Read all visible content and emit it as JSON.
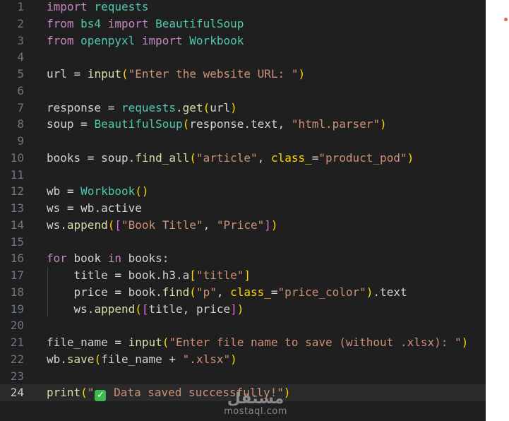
{
  "editor": {
    "active_line": 24,
    "lines": [
      {
        "n": "1",
        "tokens": [
          {
            "t": "import",
            "c": "tk-kw"
          },
          {
            "t": " requests",
            "c": "tk-mod"
          }
        ]
      },
      {
        "n": "2",
        "tokens": [
          {
            "t": "from",
            "c": "tk-kw"
          },
          {
            "t": " bs4 ",
            "c": "tk-mod"
          },
          {
            "t": "import",
            "c": "tk-kw"
          },
          {
            "t": " BeautifulSoup",
            "c": "tk-mod"
          }
        ]
      },
      {
        "n": "3",
        "tokens": [
          {
            "t": "from",
            "c": "tk-kw"
          },
          {
            "t": " openpyxl ",
            "c": "tk-mod"
          },
          {
            "t": "import",
            "c": "tk-kw"
          },
          {
            "t": " Workbook",
            "c": "tk-mod"
          }
        ]
      },
      {
        "n": "4",
        "tokens": []
      },
      {
        "n": "5",
        "tokens": [
          {
            "t": "url",
            "c": "tk-plain"
          },
          {
            "t": " = ",
            "c": "tk-plain"
          },
          {
            "t": "input",
            "c": "tk-fn"
          },
          {
            "t": "(",
            "c": "tk-br1"
          },
          {
            "t": "\"Enter the website URL: \"",
            "c": "tk-str"
          },
          {
            "t": ")",
            "c": "tk-br1"
          }
        ]
      },
      {
        "n": "6",
        "tokens": []
      },
      {
        "n": "7",
        "tokens": [
          {
            "t": "response",
            "c": "tk-plain"
          },
          {
            "t": " = ",
            "c": "tk-plain"
          },
          {
            "t": "requests",
            "c": "tk-mod"
          },
          {
            "t": ".",
            "c": "tk-plain"
          },
          {
            "t": "get",
            "c": "tk-fn"
          },
          {
            "t": "(",
            "c": "tk-br1"
          },
          {
            "t": "url",
            "c": "tk-plain"
          },
          {
            "t": ")",
            "c": "tk-br1"
          }
        ]
      },
      {
        "n": "8",
        "tokens": [
          {
            "t": "soup",
            "c": "tk-plain"
          },
          {
            "t": " = ",
            "c": "tk-plain"
          },
          {
            "t": "BeautifulSoup",
            "c": "tk-mod"
          },
          {
            "t": "(",
            "c": "tk-br1"
          },
          {
            "t": "response.text, ",
            "c": "tk-plain"
          },
          {
            "t": "\"html.parser\"",
            "c": "tk-str"
          },
          {
            "t": ")",
            "c": "tk-br1"
          }
        ]
      },
      {
        "n": "9",
        "tokens": []
      },
      {
        "n": "10",
        "tokens": [
          {
            "t": "books",
            "c": "tk-plain"
          },
          {
            "t": " = ",
            "c": "tk-plain"
          },
          {
            "t": "soup.",
            "c": "tk-plain"
          },
          {
            "t": "find_all",
            "c": "tk-fn"
          },
          {
            "t": "(",
            "c": "tk-br1"
          },
          {
            "t": "\"article\"",
            "c": "tk-str"
          },
          {
            "t": ", ",
            "c": "tk-plain"
          },
          {
            "t": "class_",
            "c": "tk-br1"
          },
          {
            "t": "=",
            "c": "tk-plain"
          },
          {
            "t": "\"product_pod\"",
            "c": "tk-str"
          },
          {
            "t": ")",
            "c": "tk-br1"
          }
        ]
      },
      {
        "n": "11",
        "tokens": []
      },
      {
        "n": "12",
        "tokens": [
          {
            "t": "wb",
            "c": "tk-plain"
          },
          {
            "t": " = ",
            "c": "tk-plain"
          },
          {
            "t": "Workbook",
            "c": "tk-mod"
          },
          {
            "t": "()",
            "c": "tk-br1"
          }
        ]
      },
      {
        "n": "13",
        "tokens": [
          {
            "t": "ws",
            "c": "tk-plain"
          },
          {
            "t": " = ",
            "c": "tk-plain"
          },
          {
            "t": "wb.active",
            "c": "tk-plain"
          }
        ]
      },
      {
        "n": "14",
        "tokens": [
          {
            "t": "ws.",
            "c": "tk-plain"
          },
          {
            "t": "append",
            "c": "tk-fn"
          },
          {
            "t": "(",
            "c": "tk-br1"
          },
          {
            "t": "[",
            "c": "tk-br2"
          },
          {
            "t": "\"Book Title\"",
            "c": "tk-str"
          },
          {
            "t": ", ",
            "c": "tk-plain"
          },
          {
            "t": "\"Price\"",
            "c": "tk-str"
          },
          {
            "t": "]",
            "c": "tk-br2"
          },
          {
            "t": ")",
            "c": "tk-br1"
          }
        ]
      },
      {
        "n": "15",
        "tokens": []
      },
      {
        "n": "16",
        "tokens": [
          {
            "t": "for",
            "c": "tk-kw"
          },
          {
            "t": " book ",
            "c": "tk-plain"
          },
          {
            "t": "in",
            "c": "tk-kw"
          },
          {
            "t": " books:",
            "c": "tk-plain"
          }
        ]
      },
      {
        "n": "17",
        "tokens": [
          {
            "t": "    title = book.h3.a",
            "c": "tk-plain"
          },
          {
            "t": "[",
            "c": "tk-br1"
          },
          {
            "t": "\"title\"",
            "c": "tk-str"
          },
          {
            "t": "]",
            "c": "tk-br1"
          }
        ]
      },
      {
        "n": "18",
        "tokens": [
          {
            "t": "    price = book.",
            "c": "tk-plain"
          },
          {
            "t": "find",
            "c": "tk-fn"
          },
          {
            "t": "(",
            "c": "tk-br1"
          },
          {
            "t": "\"p\"",
            "c": "tk-str"
          },
          {
            "t": ", ",
            "c": "tk-plain"
          },
          {
            "t": "class_",
            "c": "tk-br1"
          },
          {
            "t": "=",
            "c": "tk-plain"
          },
          {
            "t": "\"price_color\"",
            "c": "tk-str"
          },
          {
            "t": ")",
            "c": "tk-br1"
          },
          {
            "t": ".text",
            "c": "tk-plain"
          }
        ]
      },
      {
        "n": "19",
        "tokens": [
          {
            "t": "    ws.",
            "c": "tk-plain"
          },
          {
            "t": "append",
            "c": "tk-fn"
          },
          {
            "t": "(",
            "c": "tk-br1"
          },
          {
            "t": "[",
            "c": "tk-br2"
          },
          {
            "t": "title, price",
            "c": "tk-plain"
          },
          {
            "t": "]",
            "c": "tk-br2"
          },
          {
            "t": ")",
            "c": "tk-br1"
          }
        ]
      },
      {
        "n": "20",
        "tokens": []
      },
      {
        "n": "21",
        "tokens": [
          {
            "t": "file_name",
            "c": "tk-plain"
          },
          {
            "t": " = ",
            "c": "tk-plain"
          },
          {
            "t": "input",
            "c": "tk-fn"
          },
          {
            "t": "(",
            "c": "tk-br1"
          },
          {
            "t": "\"Enter file name to save (without .xlsx): \"",
            "c": "tk-str"
          },
          {
            "t": ")",
            "c": "tk-br1"
          }
        ]
      },
      {
        "n": "22",
        "tokens": [
          {
            "t": "wb.",
            "c": "tk-plain"
          },
          {
            "t": "save",
            "c": "tk-fn"
          },
          {
            "t": "(",
            "c": "tk-br1"
          },
          {
            "t": "file_name + ",
            "c": "tk-plain"
          },
          {
            "t": "\".xlsx\"",
            "c": "tk-str"
          },
          {
            "t": ")",
            "c": "tk-br1"
          }
        ]
      },
      {
        "n": "23",
        "tokens": []
      },
      {
        "n": "24",
        "tokens": [
          {
            "t": "print",
            "c": "tk-fn"
          },
          {
            "t": "(",
            "c": "tk-br1"
          },
          {
            "t": "\"",
            "c": "tk-str"
          },
          {
            "t": "✓",
            "c": "emoji"
          },
          {
            "t": " Data saved successfully!\"",
            "c": "tk-str"
          },
          {
            "t": ")",
            "c": "tk-br1"
          }
        ]
      }
    ]
  },
  "watermark": {
    "glyph": "مستقل",
    "name": "mostaql.com"
  },
  "colors": {
    "background": "#1f1f1f",
    "active_line": "#2a2a2a",
    "string": "#ce9178",
    "keyword": "#c586c0",
    "function": "#dcdcaa",
    "module": "#4ec9b0"
  }
}
